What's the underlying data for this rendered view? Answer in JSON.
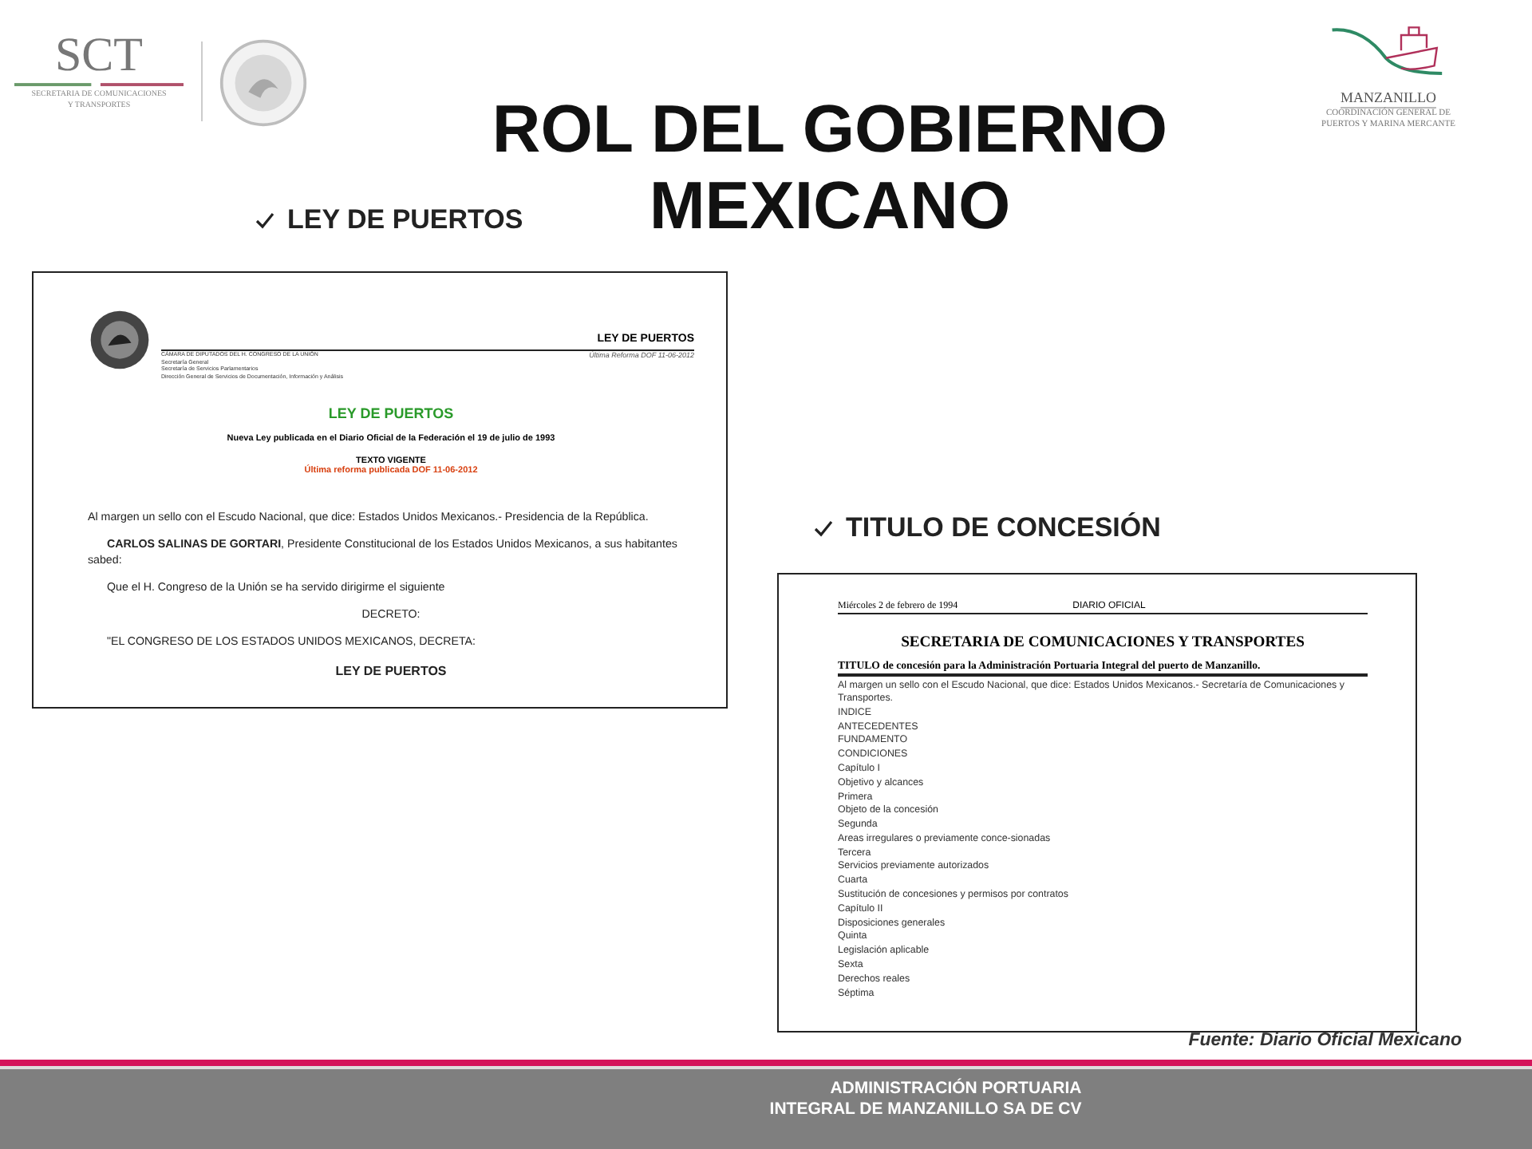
{
  "header": {
    "sct_logo": {
      "acronym": "SCT",
      "caption_lines": [
        "SECRETARIA DE COMUNICACIONES",
        "Y TRANSPORTES"
      ]
    },
    "title_lines": [
      "ROL DEL GOBIERNO",
      "MEXICANO"
    ],
    "manzanillo_logo": {
      "name": "MANZANILLO",
      "caption_lines": [
        "COORDINACIÓN GENERAL DE",
        "PUERTOS Y MARINA MERCANTE"
      ]
    }
  },
  "sections": [
    {
      "label": "LEY DE PUERTOS",
      "document": {
        "kind": "ley",
        "header_lines": [
          "CÁMARA DE DIPUTADOS DEL H. CONGRESO DE LA UNIÓN",
          "Secretaría General",
          "Secretaría de Servicios Parlamentarios",
          "Dirección General de Servicios de Documentación, Información y Análisis"
        ],
        "header_title": "LEY DE PUERTOS",
        "header_reform": "Última Reforma DOF 11-06-2012",
        "title": "LEY DE PUERTOS",
        "subtitle": "Nueva Ley publicada en el Diario Oficial de la Federación el 19 de julio de 1993",
        "status": "TEXTO VIGENTE",
        "reform": "Última reforma publicada DOF 11-06-2012",
        "paragraphs": [
          {
            "kind": "plain",
            "text": "Al margen un sello con el Escudo Nacional, que dice: Estados Unidos Mexicanos.- Presidencia de la República."
          },
          {
            "kind": "indent",
            "text": "**CARLOS SALINAS DE GORTARI**, Presidente Constitucional de los Estados Unidos Mexicanos, a sus habitantes sabed:"
          },
          {
            "kind": "indent",
            "text": "Que el H. Congreso de la Unión se ha servido dirigirme el siguiente"
          },
          {
            "kind": "center",
            "text": "DECRETO:"
          },
          {
            "kind": "indent",
            "text": "\"EL CONGRESO DE LOS ESTADOS UNIDOS MEXICANOS, DECRETA:"
          },
          {
            "kind": "heading",
            "text": "LEY DE PUERTOS"
          }
        ]
      }
    },
    {
      "label": "TITULO DE CONCESIÓN",
      "document": {
        "kind": "titulo",
        "date": "Miércoles 2 de febrero de 1994",
        "publication": "DIARIO OFICIAL",
        "title": "SECRETARIA DE COMUNICACIONES Y TRANSPORTES",
        "subtitle": "TITULO de concesión para la Administración Portuaria Integral del puerto de Manzanillo.",
        "intro": "Al margen un sello con el Escudo Nacional, que dice: Estados Unidos Mexicanos.- Secretaría de Comunicaciones y Transportes.",
        "items": [
          "INDICE",
          "ANTECEDENTES",
          "FUNDAMENTO",
          "CONDICIONES",
          "Capítulo I",
          "Objetivo y alcances",
          "Primera",
          "Objeto de la concesión",
          "Segunda",
          "Areas irregulares o previamente conce-sionadas",
          "Tercera",
          "Servicios previamente autorizados",
          "Cuarta",
          "Sustitución de concesiones y permisos por contratos",
          "Capítulo II",
          "Disposiciones generales",
          "Quinta",
          "Legislación aplicable",
          "Sexta",
          "Derechos reales",
          "Séptima"
        ]
      }
    }
  ],
  "source": "Fuente: Diario Oficial Mexicano",
  "footer_lines": [
    "ADMINISTRACIÓN PORTUARIA",
    "INTEGRAL DE MANZANILLO SA DE CV"
  ]
}
